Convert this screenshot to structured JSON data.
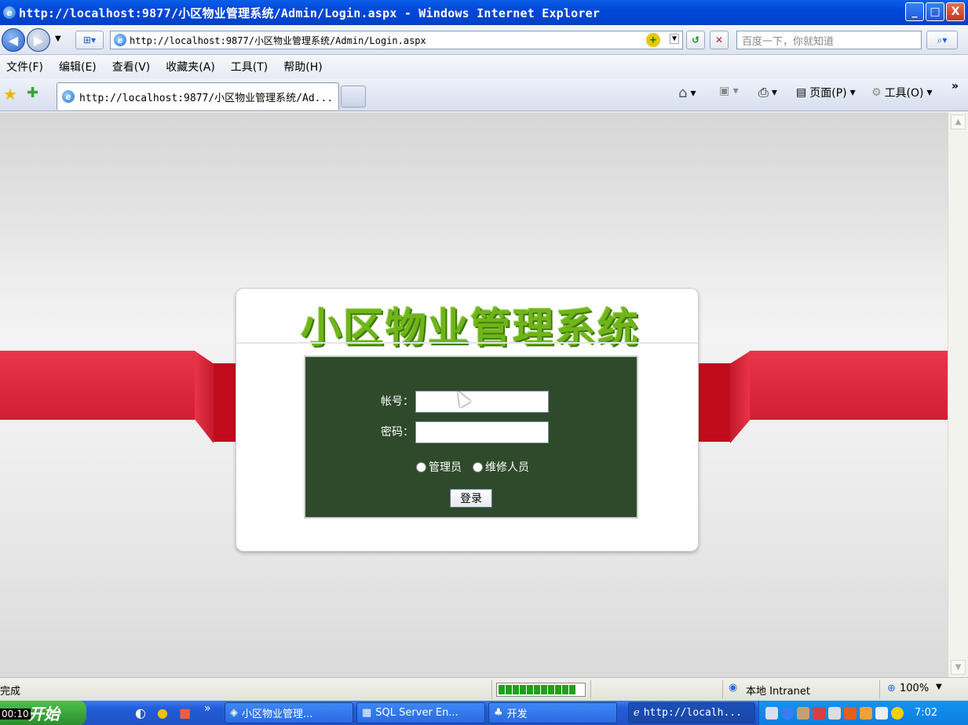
{
  "window": {
    "title": "http://localhost:9877/小区物业管理系统/Admin/Login.aspx - Windows Internet Explorer",
    "buttons": {
      "minimize": "_",
      "maximize": "□",
      "close": "X"
    }
  },
  "addressbar": {
    "url": "http://localhost:9877/小区物业管理系统/Admin/Login.aspx",
    "search_placeholder": "百度一下，你就知道"
  },
  "menu": [
    "文件(F)",
    "编辑(E)",
    "查看(V)",
    "收藏夹(A)",
    "工具(T)",
    "帮助(H)"
  ],
  "tab": {
    "label": "http://localhost:9877/小区物业管理系统/Ad..."
  },
  "commandbar": {
    "page": "页面(P)",
    "tools": "工具(O)"
  },
  "login": {
    "system_title": "小区物业管理系统",
    "account_label": "帐号：",
    "password_label": "密码：",
    "account_value": "",
    "password_value": "",
    "radio_admin": "管理员",
    "radio_repair": "维修人员",
    "login_button": "登录"
  },
  "status": {
    "text": "完成",
    "zone": "本地 Intranet",
    "zoom": "100%",
    "progress": 1.0
  },
  "taskbar": {
    "time_left": "00:10",
    "start": "开始",
    "tasks": [
      "小区物业管理...",
      "SQL Server En...",
      "开发",
      "http://localh..."
    ],
    "clock": "7:02"
  }
}
